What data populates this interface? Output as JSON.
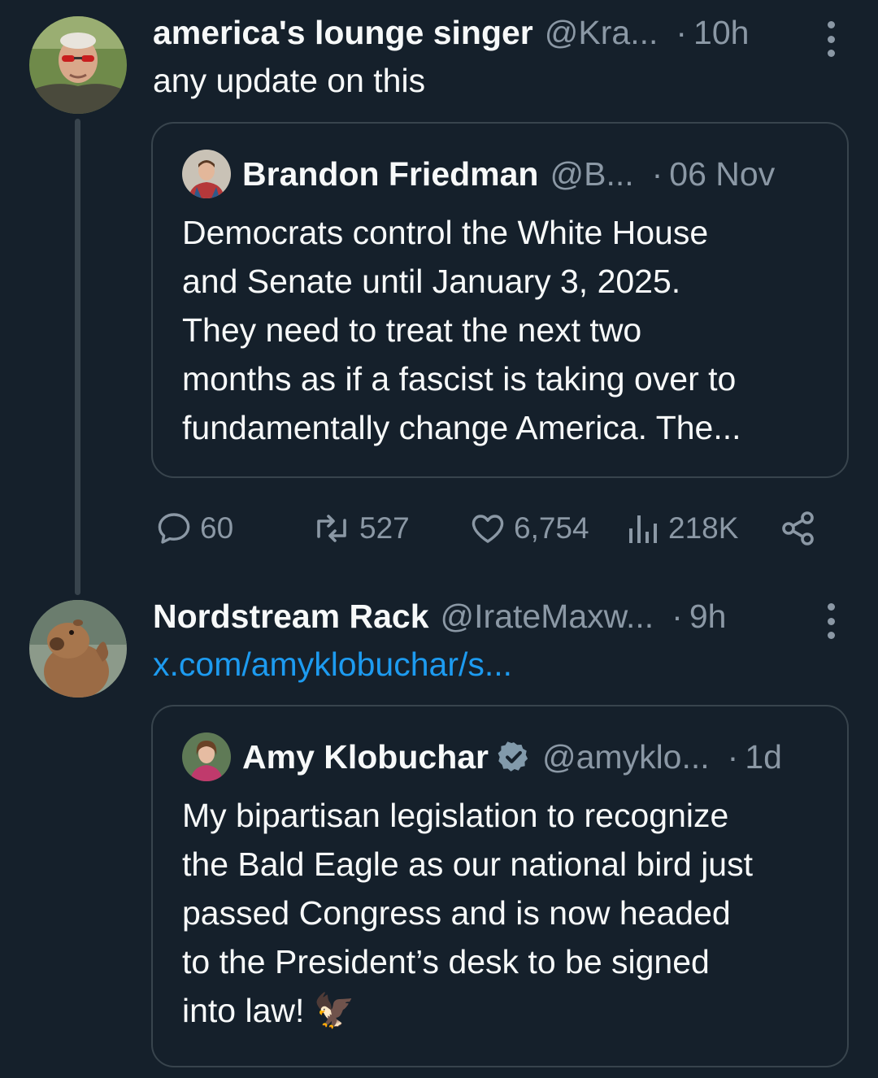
{
  "tweets": [
    {
      "author_name": "america's lounge singer",
      "author_handle": "@Kra...",
      "separator": "·",
      "time": "10h",
      "text": "any update on this",
      "quote": {
        "author_name": "Brandon Friedman",
        "author_handle": "@B...",
        "separator": "·",
        "time": "06 Nov",
        "lines": [
          "Democrats control the White House",
          "and Senate until January 3, 2025.",
          "They need to treat the next two",
          "months as if a fascist is taking over to",
          "fundamentally change America. The..."
        ]
      },
      "actions": {
        "replies": "60",
        "reposts": "527",
        "likes": "6,754",
        "views": "218K"
      }
    },
    {
      "author_name": "Nordstream Rack",
      "author_handle": "@IrateMaxw...",
      "separator": "·",
      "time": "9h",
      "link": "x.com/amyklobuchar/s...",
      "quote": {
        "author_name": "Amy Klobuchar",
        "author_handle": "@amyklo...",
        "separator": "·",
        "time": "1d",
        "verified": true,
        "lines": [
          "My bipartisan legislation to recognize",
          "the Bald Eagle as our national bird just",
          "passed Congress and is now headed",
          "to the President’s desk to be signed",
          "into law! 🦅"
        ]
      }
    }
  ],
  "colors": {
    "background": "#15202b",
    "text": "#f7f9f9",
    "secondary": "#8b98a5",
    "link": "#1d9bf0",
    "border": "#38444d"
  }
}
